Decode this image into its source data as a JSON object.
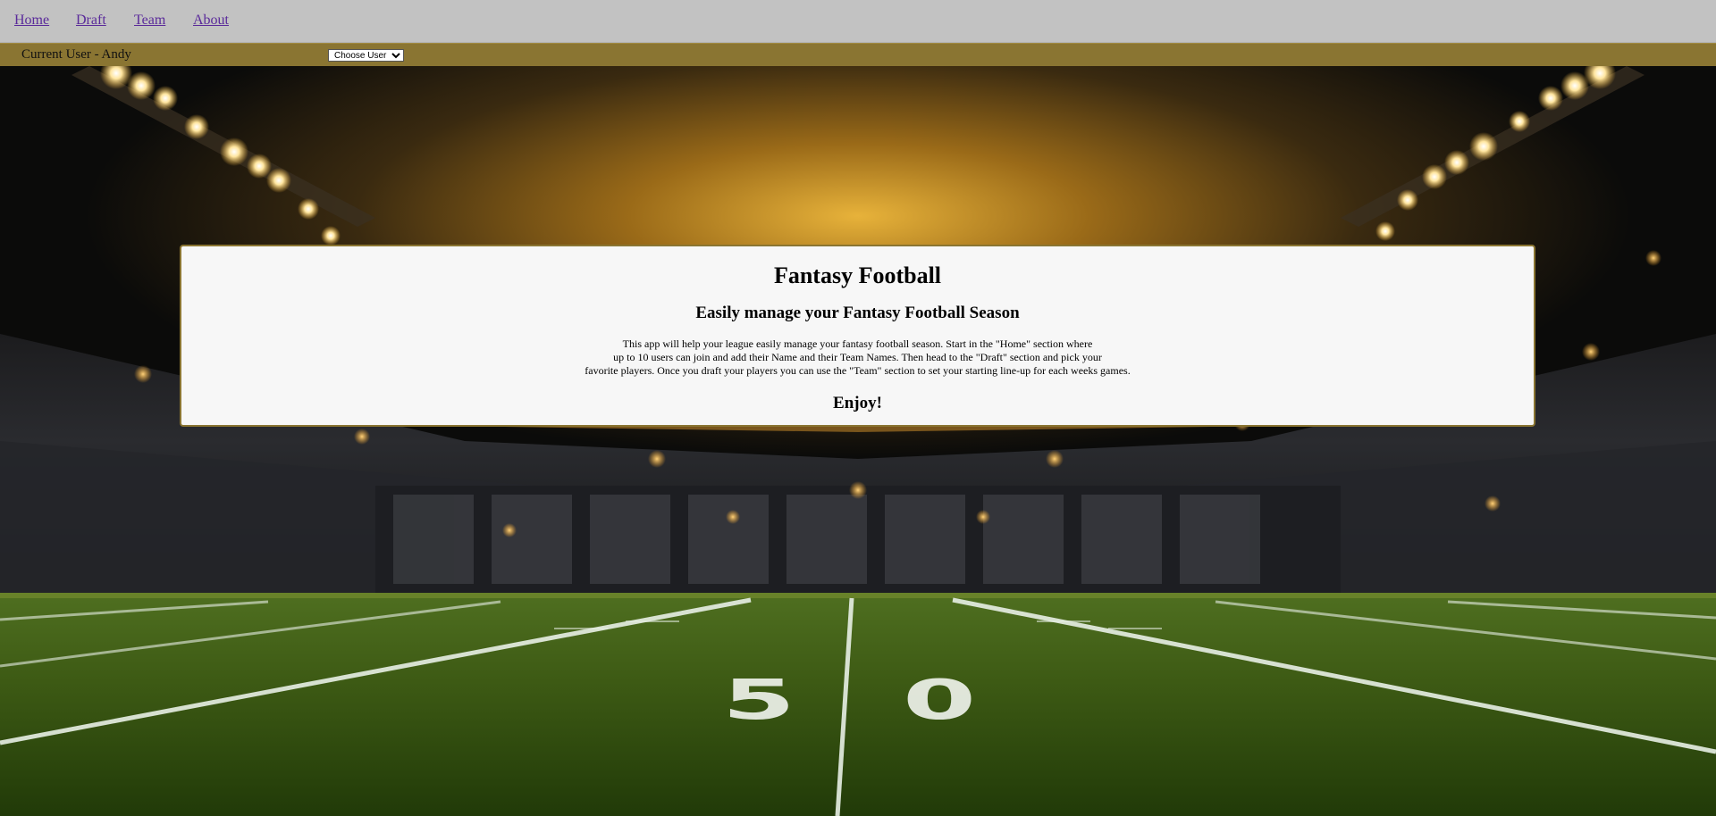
{
  "nav": {
    "items": [
      {
        "label": "Home"
      },
      {
        "label": "Draft"
      },
      {
        "label": "Team"
      },
      {
        "label": "About"
      }
    ]
  },
  "user_bar": {
    "current_user": "Current User - Andy",
    "select_value": "Choose User"
  },
  "card": {
    "title": "Fantasy Football",
    "subtitle": "Easily manage your Fantasy Football Season",
    "description_lines": [
      "This app will help your league easily manage your fantasy football season. Start in the \"Home\" section where",
      "up to 10 users can join and add their Name and their Team Names. Then head to the \"Draft\" section and pick your",
      "favorite players. Once you draft your players you can use the \"Team\" section to set your starting line-up for each weeks games."
    ],
    "closing": "Enjoy!"
  },
  "background": {
    "field_marking": "50",
    "colors": {
      "nav_bg": "#c2c2c2",
      "user_bar_bg": "#8a7532",
      "link": "#5a2a9a",
      "card_bg": "#f7f7f7",
      "card_border": "#8a7532"
    }
  }
}
